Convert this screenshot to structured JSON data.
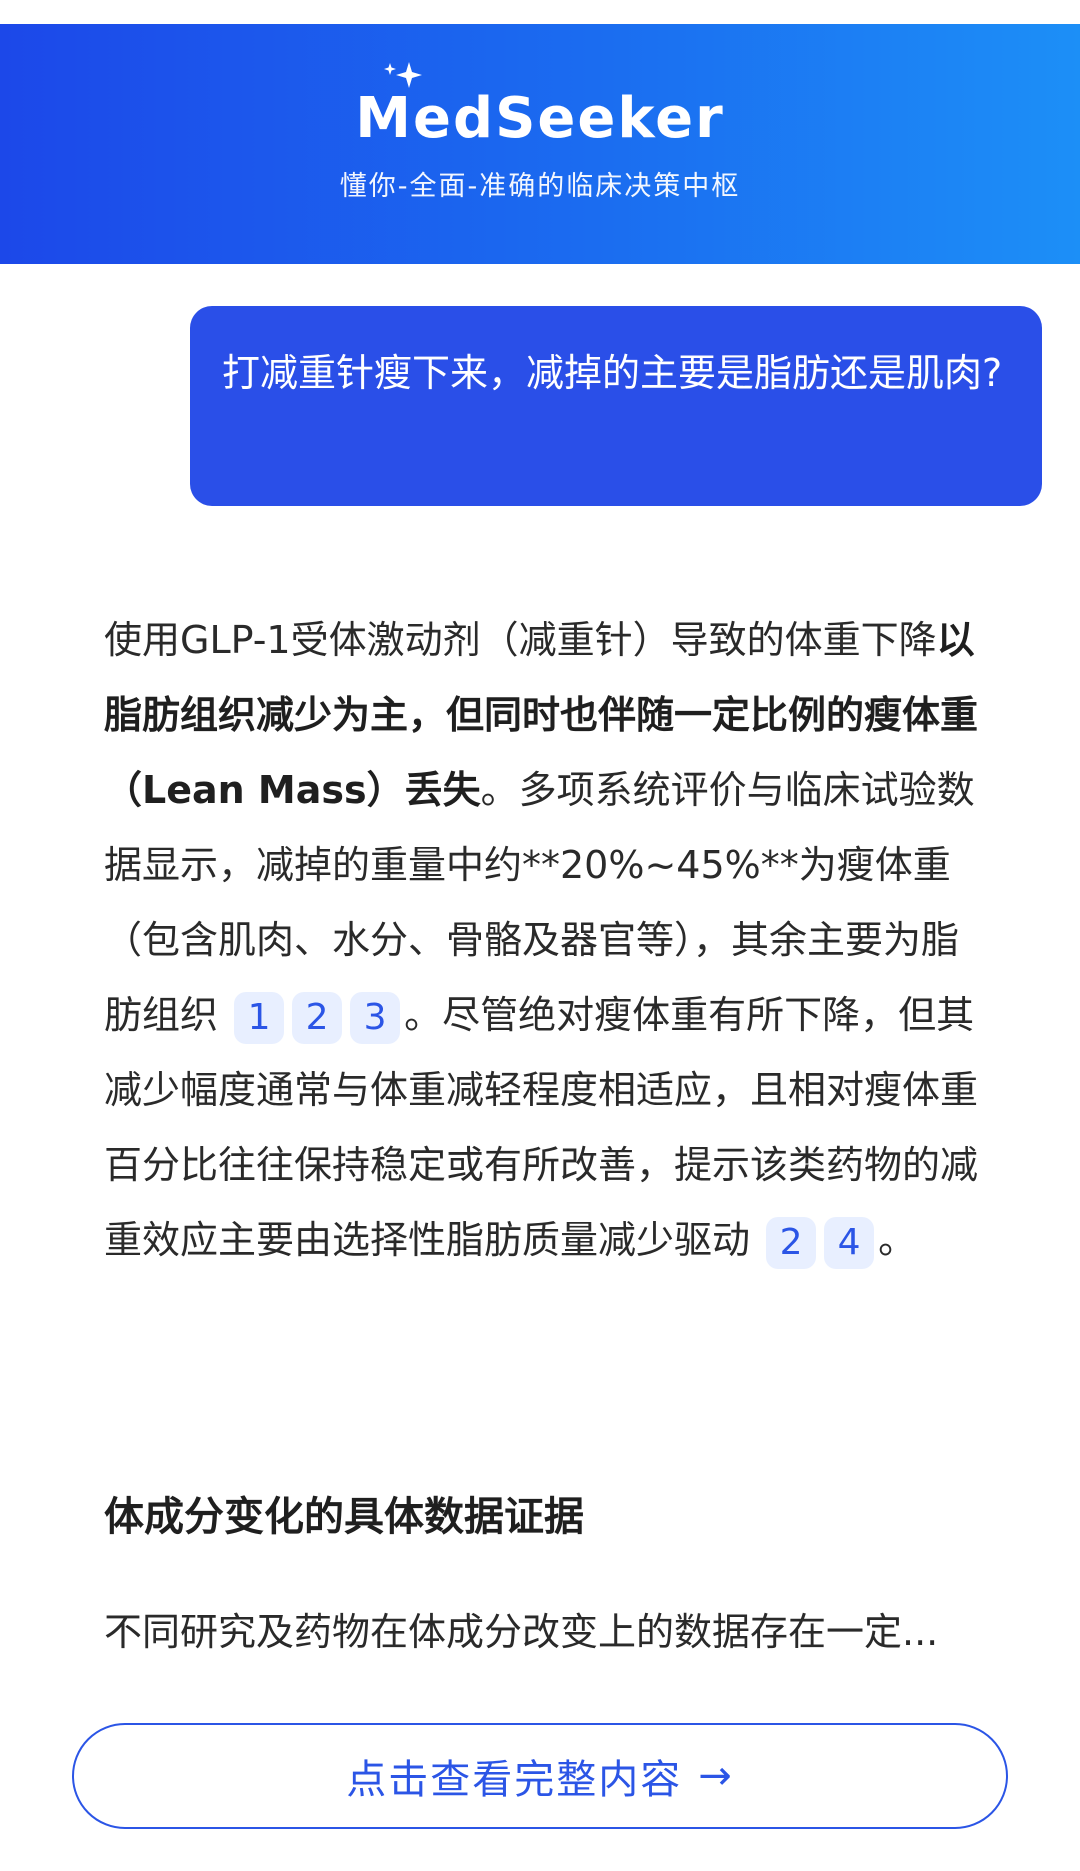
{
  "header": {
    "logo": "MedSeeker",
    "tagline": "懂你-全面-准确的临床决策中枢"
  },
  "question": "打减重针瘦下来，减掉的主要是脂肪还是肌肉?",
  "answer": {
    "p1_a": "使用GLP-1受体激动剂（减重针）导致的体重下降",
    "p1_bold": "以脂肪组织减少为主，但同时也伴随一定比例的瘦体重（Lean Mass）丢失",
    "p1_b": "。多项系统评价与临床试验数据显示，减掉的重量中约**20%~45%**为瘦体重（包含肌肉、水分、骨骼及器官等），其余主要为脂肪组织",
    "cites1": [
      "1",
      "2",
      "3"
    ],
    "p1_c": "。尽管绝对瘦体重有所下降，但其减少幅度通常与体重减轻程度相适应，且相对瘦体重百分比往往保持稳定或有所改善，提示该类药物的减重效应主要由选择性脂肪质量减少驱动",
    "cites2": [
      "2",
      "4"
    ],
    "p1_end": "。",
    "heading": "体成分变化的具体数据证据",
    "p2": "不同研究及药物在体成分改变上的数据存在一定..."
  },
  "more_button": {
    "label": "点击查看完整内容",
    "icon": "arrow-right-icon"
  },
  "colors": {
    "brand": "#1c5ef0",
    "accent": "#2b55e6",
    "bubble": "#2a4fe8",
    "cite_bg": "#e8efff"
  }
}
